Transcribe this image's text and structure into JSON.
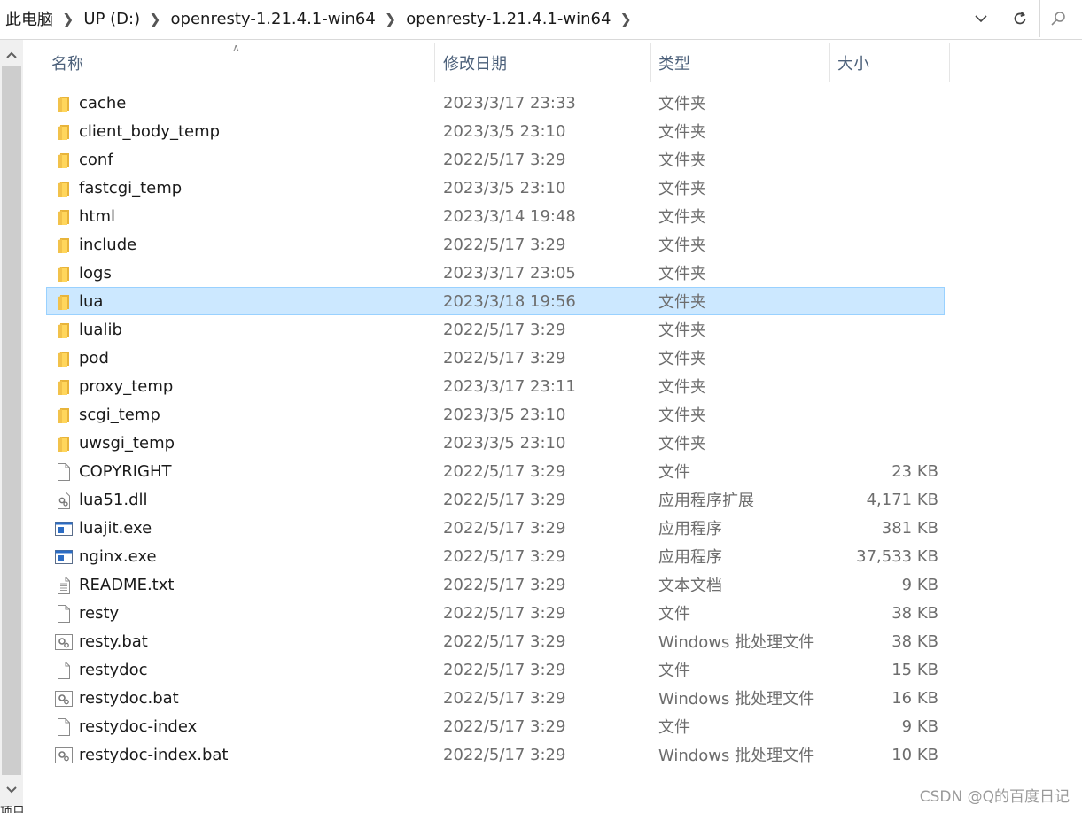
{
  "breadcrumb": [
    "此电脑",
    "UP (D:)",
    "openresty-1.21.4.1-win64",
    "openresty-1.21.4.1-win64"
  ],
  "columns": {
    "name": "名称",
    "date": "修改日期",
    "type": "类型",
    "size": "大小"
  },
  "files": [
    {
      "name": "cache",
      "date": "2023/3/17 23:33",
      "type": "文件夹",
      "size": "",
      "icon": "folder-icon"
    },
    {
      "name": "client_body_temp",
      "date": "2023/3/5 23:10",
      "type": "文件夹",
      "size": "",
      "icon": "folder-icon"
    },
    {
      "name": "conf",
      "date": "2022/5/17 3:29",
      "type": "文件夹",
      "size": "",
      "icon": "folder-icon"
    },
    {
      "name": "fastcgi_temp",
      "date": "2023/3/5 23:10",
      "type": "文件夹",
      "size": "",
      "icon": "folder-icon"
    },
    {
      "name": "html",
      "date": "2023/3/14 19:48",
      "type": "文件夹",
      "size": "",
      "icon": "folder-icon"
    },
    {
      "name": "include",
      "date": "2022/5/17 3:29",
      "type": "文件夹",
      "size": "",
      "icon": "folder-icon"
    },
    {
      "name": "logs",
      "date": "2023/3/17 23:05",
      "type": "文件夹",
      "size": "",
      "icon": "folder-icon"
    },
    {
      "name": "lua",
      "date": "2023/3/18 19:56",
      "type": "文件夹",
      "size": "",
      "icon": "folder-icon",
      "selected": true
    },
    {
      "name": "lualib",
      "date": "2022/5/17 3:29",
      "type": "文件夹",
      "size": "",
      "icon": "folder-icon"
    },
    {
      "name": "pod",
      "date": "2022/5/17 3:29",
      "type": "文件夹",
      "size": "",
      "icon": "folder-icon"
    },
    {
      "name": "proxy_temp",
      "date": "2023/3/17 23:11",
      "type": "文件夹",
      "size": "",
      "icon": "folder-icon"
    },
    {
      "name": "scgi_temp",
      "date": "2023/3/5 23:10",
      "type": "文件夹",
      "size": "",
      "icon": "folder-icon"
    },
    {
      "name": "uwsgi_temp",
      "date": "2023/3/5 23:10",
      "type": "文件夹",
      "size": "",
      "icon": "folder-icon"
    },
    {
      "name": "COPYRIGHT",
      "date": "2022/5/17 3:29",
      "type": "文件",
      "size": "23 KB",
      "icon": "file-icon"
    },
    {
      "name": "lua51.dll",
      "date": "2022/5/17 3:29",
      "type": "应用程序扩展",
      "size": "4,171 KB",
      "icon": "dll-icon"
    },
    {
      "name": "luajit.exe",
      "date": "2022/5/17 3:29",
      "type": "应用程序",
      "size": "381 KB",
      "icon": "exe-icon"
    },
    {
      "name": "nginx.exe",
      "date": "2022/5/17 3:29",
      "type": "应用程序",
      "size": "37,533 KB",
      "icon": "exe-icon"
    },
    {
      "name": "README.txt",
      "date": "2022/5/17 3:29",
      "type": "文本文档",
      "size": "9 KB",
      "icon": "text-file-icon"
    },
    {
      "name": "resty",
      "date": "2022/5/17 3:29",
      "type": "文件",
      "size": "38 KB",
      "icon": "file-icon"
    },
    {
      "name": "resty.bat",
      "date": "2022/5/17 3:29",
      "type": "Windows 批处理文件",
      "size": "38 KB",
      "icon": "bat-icon"
    },
    {
      "name": "restydoc",
      "date": "2022/5/17 3:29",
      "type": "文件",
      "size": "15 KB",
      "icon": "file-icon"
    },
    {
      "name": "restydoc.bat",
      "date": "2022/5/17 3:29",
      "type": "Windows 批处理文件",
      "size": "16 KB",
      "icon": "bat-icon"
    },
    {
      "name": "restydoc-index",
      "date": "2022/5/17 3:29",
      "type": "文件",
      "size": "9 KB",
      "icon": "file-icon"
    },
    {
      "name": "restydoc-index.bat",
      "date": "2022/5/17 3:29",
      "type": "Windows 批处理文件",
      "size": "10 KB",
      "icon": "bat-icon"
    }
  ],
  "watermark": "CSDN @Q的百度日记",
  "statusbar": "项目",
  "colors": {
    "selection": "#cce8ff",
    "selection_border": "#99d1ff",
    "folder": "#f6c94a",
    "header_text": "#4c607a"
  }
}
